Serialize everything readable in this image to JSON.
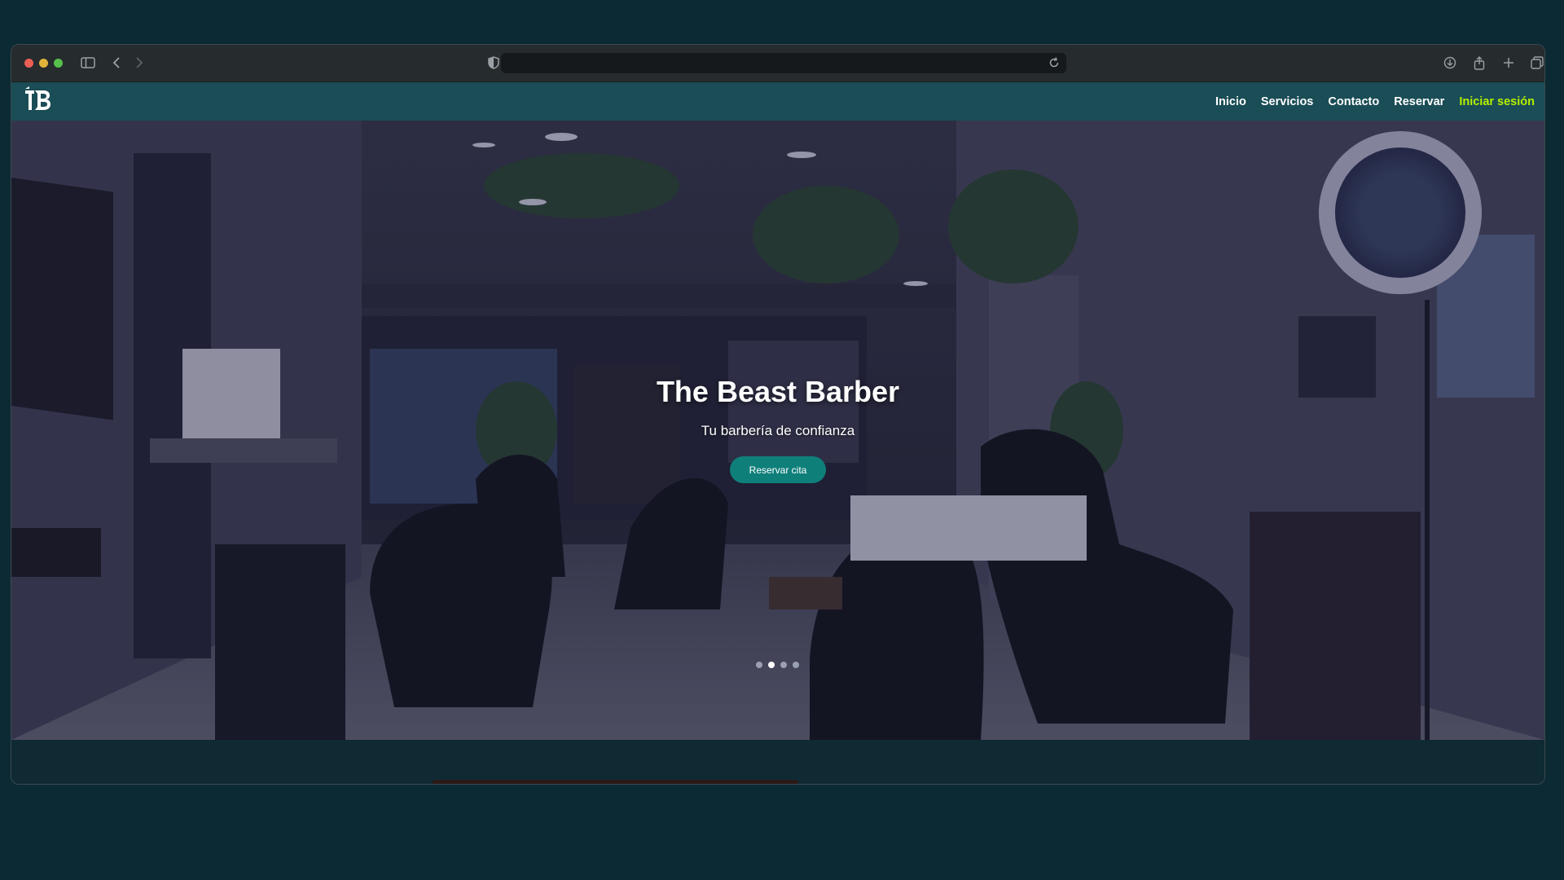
{
  "browser": {
    "icons": [
      "sidebar-icon",
      "back-icon",
      "forward-icon",
      "shield-icon",
      "reload-icon",
      "download-icon",
      "share-icon",
      "new-tab-icon",
      "tabs-overview-icon"
    ],
    "url": ""
  },
  "navbar": {
    "links": [
      "Inicio",
      "Servicios",
      "Contacto",
      "Reservar"
    ],
    "login": "Iniciar sesión",
    "login_color": "#b6f000",
    "background": "#1a4d56"
  },
  "hero": {
    "title": "The Beast Barber",
    "subtitle": "Tu barbería de confianza",
    "cta": "Reservar cita",
    "cta_color": "#0f7f7a",
    "slides_total": 4,
    "active_slide": 2
  }
}
